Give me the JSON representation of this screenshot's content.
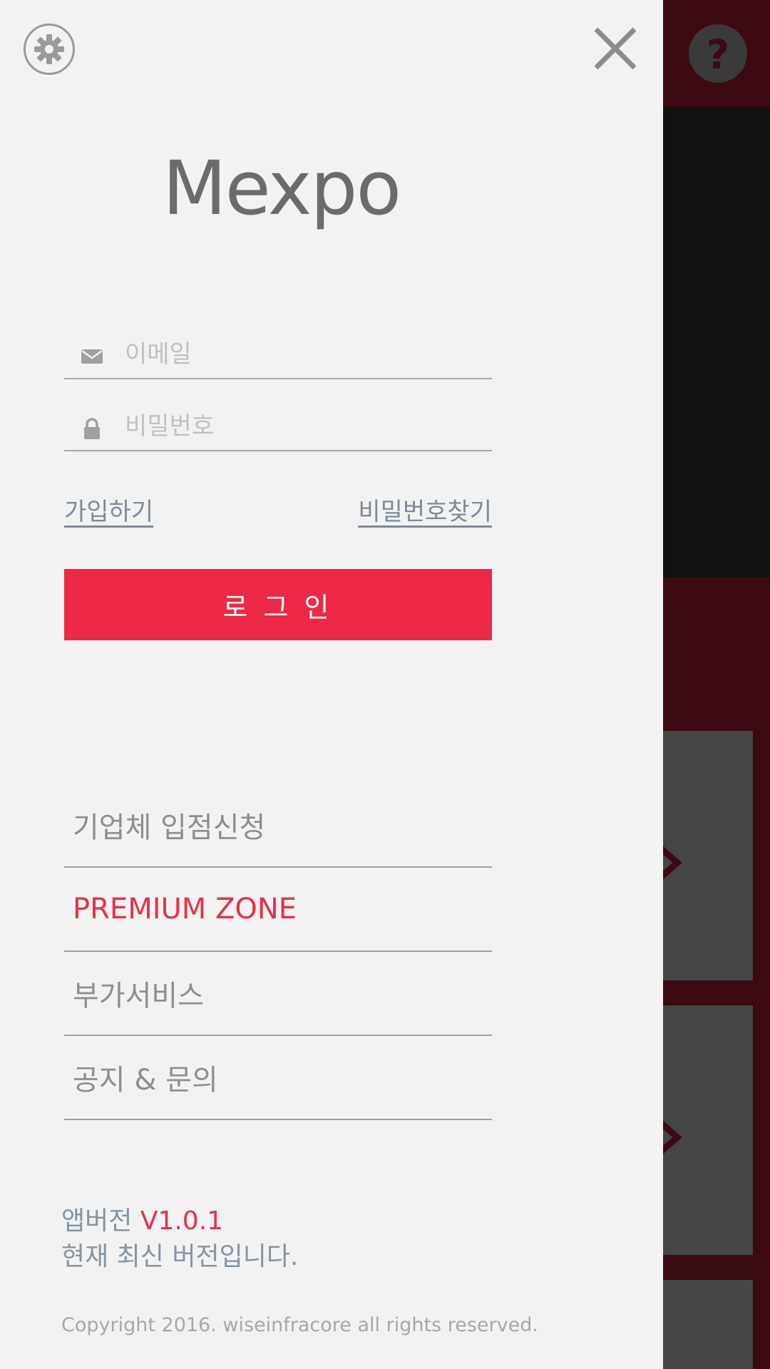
{
  "app": {
    "logo_text": "Mexpo"
  },
  "colors": {
    "accent": "#ec2845",
    "drawer_bg": "#f2f2f2",
    "background_dark_red": "#3b0a12",
    "muted_text": "#8e8e8e",
    "link_text": "#7d8a97"
  },
  "header": {
    "settings_icon": "gear-icon",
    "close_icon": "close-icon",
    "help_icon": "help-icon"
  },
  "login": {
    "email_placeholder": "이메일",
    "email_value": "",
    "email_icon": "envelope-icon",
    "password_placeholder": "비밀번호",
    "password_value": "",
    "password_icon": "lock-icon",
    "signup_label": "가입하기",
    "find_password_label": "비밀번호찾기",
    "login_label": "로그인"
  },
  "menu": {
    "items": [
      {
        "label": "기업체 입점신청"
      },
      {
        "label": "PREMIUM ZONE"
      },
      {
        "label": "부가서비스"
      },
      {
        "label": "공지 &  문의"
      }
    ]
  },
  "version": {
    "prefix": "앱버전 ",
    "number": "V1.0.1",
    "status": "현재 최신 버전입니다."
  },
  "footer": {
    "copyright": "Copyright 2016. wiseinfracore all rights reserved."
  }
}
